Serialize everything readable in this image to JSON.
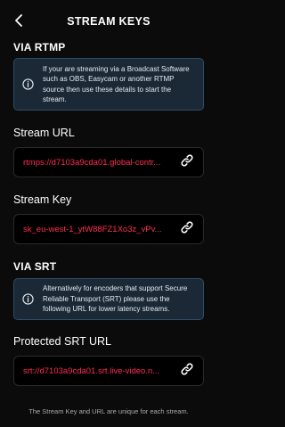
{
  "header": {
    "title": "STREAM KEYS"
  },
  "rtmp": {
    "section_title": "VIA RTMP",
    "info_text": "If your are streaming via a Broadcast Software such as OBS, Easycam or another RTMP source then use these details to start the stream.",
    "stream_url": {
      "label": "Stream URL",
      "value": "rtmps://d7103a9cda01.global-contr..."
    },
    "stream_key": {
      "label": "Stream Key",
      "value": "sk_eu-west-1_ytW88FZ1Xo3z_vPv..."
    }
  },
  "srt": {
    "section_title": "VIA SRT",
    "info_text": "Alternatively for encoders that support Secure Reliable Transport (SRT) please use the following URL for lower latency streams.",
    "protected_url": {
      "label": "Protected SRT URL",
      "value": "srt://d7103a9cda01.srt.live-video.n..."
    }
  },
  "footer": {
    "note": "The Stream Key and URL are unique for each stream."
  },
  "colors": {
    "background": "#0b0b0b",
    "accent_value": "#ff2d4f",
    "info_bg": "#1b2836",
    "info_border": "#2f4d67"
  },
  "icons": {
    "back": "chevron-left-icon",
    "info": "info-circle-icon",
    "copy": "link-icon"
  }
}
